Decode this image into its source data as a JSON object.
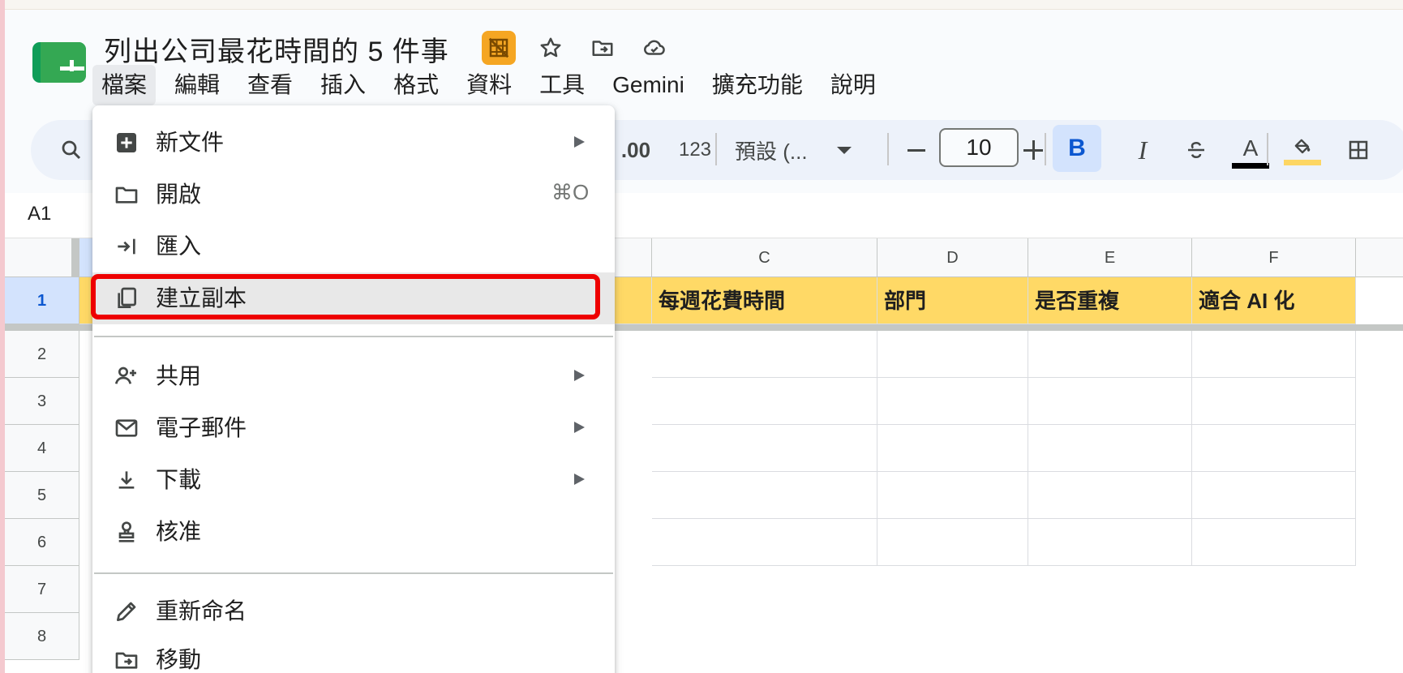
{
  "app": {
    "document_title": "列出公司最花時間的 5 件事"
  },
  "menubar": {
    "items": [
      "檔案",
      "編輯",
      "查看",
      "插入",
      "格式",
      "資料",
      "工具",
      "Gemini",
      "擴充功能",
      "說明"
    ]
  },
  "toolbar": {
    "decimal_increase_label": ".00",
    "number_format_label": "123",
    "font_label": "預設 (...",
    "font_size": "10",
    "bold_label": "B",
    "italic_label": "I",
    "text_color_label": "A",
    "text_color": "#000000",
    "fill_color": "#fdd663"
  },
  "formula_bar": {
    "cell_ref": "A1"
  },
  "sheet": {
    "columns": [
      "C",
      "D",
      "E",
      "F"
    ],
    "row_numbers": [
      "1",
      "2",
      "3",
      "4",
      "5",
      "6",
      "7",
      "8"
    ],
    "header_row": [
      "每週花費時間",
      "部門",
      "是否重複",
      "適合 AI 化"
    ],
    "header_fill": "#ffd966"
  },
  "file_menu": {
    "items": [
      {
        "label": "新文件",
        "icon": "new-doc-icon",
        "submenu": true
      },
      {
        "label": "開啟",
        "icon": "folder-icon",
        "shortcut": "⌘O"
      },
      {
        "label": "匯入",
        "icon": "import-icon"
      },
      {
        "label": "建立副本",
        "icon": "copy-icon",
        "highlighted": true
      },
      {
        "label": "共用",
        "icon": "share-person-icon",
        "submenu": true
      },
      {
        "label": "電子郵件",
        "icon": "email-icon",
        "submenu": true
      },
      {
        "label": "下載",
        "icon": "download-icon",
        "submenu": true
      },
      {
        "label": "核准",
        "icon": "approval-stamp-icon"
      },
      {
        "label": "重新命名",
        "icon": "pencil-icon"
      },
      {
        "label": "移動",
        "icon": "move-folder-icon"
      }
    ],
    "highlight_color": "#ee0000"
  }
}
